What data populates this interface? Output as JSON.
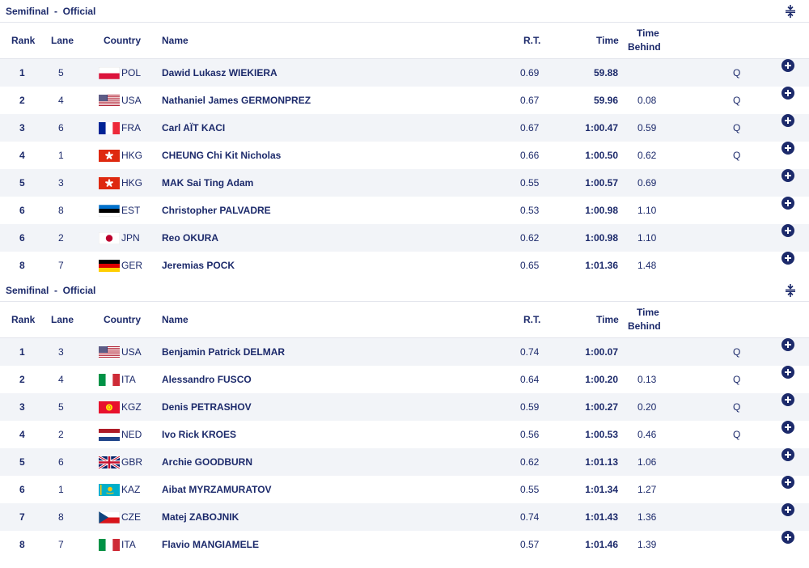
{
  "columns": {
    "rank": "Rank",
    "lane": "Lane",
    "country": "Country",
    "name": "Name",
    "rt": "R.T.",
    "time": "Time",
    "behind_line1": "Time",
    "behind_line2": "Behind"
  },
  "icons": {
    "collapse": "collapse-icon",
    "expand": "plus-circle-icon"
  },
  "colors": {
    "accent": "#1c2a6b",
    "row_alt": "#f2f4f8",
    "divider": "#e3e5ec"
  },
  "heats": [
    {
      "title": "Semifinal  -  Official",
      "rows": [
        {
          "rank": "1",
          "lane": "5",
          "country": "POL",
          "name": "Dawid Lukasz WIEKIERA",
          "rt": "0.69",
          "time": "59.88",
          "behind": "",
          "q": "Q"
        },
        {
          "rank": "2",
          "lane": "4",
          "country": "USA",
          "name": "Nathaniel James GERMONPREZ",
          "rt": "0.67",
          "time": "59.96",
          "behind": "0.08",
          "q": "Q"
        },
        {
          "rank": "3",
          "lane": "6",
          "country": "FRA",
          "name": "Carl AÏT KACI",
          "rt": "0.67",
          "time": "1:00.47",
          "behind": "0.59",
          "q": "Q"
        },
        {
          "rank": "4",
          "lane": "1",
          "country": "HKG",
          "name": "CHEUNG Chi Kit Nicholas",
          "rt": "0.66",
          "time": "1:00.50",
          "behind": "0.62",
          "q": "Q"
        },
        {
          "rank": "5",
          "lane": "3",
          "country": "HKG",
          "name": "MAK Sai Ting Adam",
          "rt": "0.55",
          "time": "1:00.57",
          "behind": "0.69",
          "q": ""
        },
        {
          "rank": "6",
          "lane": "8",
          "country": "EST",
          "name": "Christopher PALVADRE",
          "rt": "0.53",
          "time": "1:00.98",
          "behind": "1.10",
          "q": ""
        },
        {
          "rank": "6",
          "lane": "2",
          "country": "JPN",
          "name": "Reo OKURA",
          "rt": "0.62",
          "time": "1:00.98",
          "behind": "1.10",
          "q": ""
        },
        {
          "rank": "8",
          "lane": "7",
          "country": "GER",
          "name": "Jeremias POCK",
          "rt": "0.65",
          "time": "1:01.36",
          "behind": "1.48",
          "q": ""
        }
      ]
    },
    {
      "title": "Semifinal  -  Official",
      "rows": [
        {
          "rank": "1",
          "lane": "3",
          "country": "USA",
          "name": "Benjamin Patrick DELMAR",
          "rt": "0.74",
          "time": "1:00.07",
          "behind": "",
          "q": "Q"
        },
        {
          "rank": "2",
          "lane": "4",
          "country": "ITA",
          "name": "Alessandro FUSCO",
          "rt": "0.64",
          "time": "1:00.20",
          "behind": "0.13",
          "q": "Q"
        },
        {
          "rank": "3",
          "lane": "5",
          "country": "KGZ",
          "name": "Denis PETRASHOV",
          "rt": "0.59",
          "time": "1:00.27",
          "behind": "0.20",
          "q": "Q"
        },
        {
          "rank": "4",
          "lane": "2",
          "country": "NED",
          "name": "Ivo Rick KROES",
          "rt": "0.56",
          "time": "1:00.53",
          "behind": "0.46",
          "q": "Q"
        },
        {
          "rank": "5",
          "lane": "6",
          "country": "GBR",
          "name": "Archie GOODBURN",
          "rt": "0.62",
          "time": "1:01.13",
          "behind": "1.06",
          "q": ""
        },
        {
          "rank": "6",
          "lane": "1",
          "country": "KAZ",
          "name": "Aibat MYRZAMURATOV",
          "rt": "0.55",
          "time": "1:01.34",
          "behind": "1.27",
          "q": ""
        },
        {
          "rank": "7",
          "lane": "8",
          "country": "CZE",
          "name": "Matej ZABOJNIK",
          "rt": "0.74",
          "time": "1:01.43",
          "behind": "1.36",
          "q": ""
        },
        {
          "rank": "8",
          "lane": "7",
          "country": "ITA",
          "name": "Flavio MANGIAMELE",
          "rt": "0.57",
          "time": "1:01.46",
          "behind": "1.39",
          "q": ""
        }
      ]
    }
  ]
}
